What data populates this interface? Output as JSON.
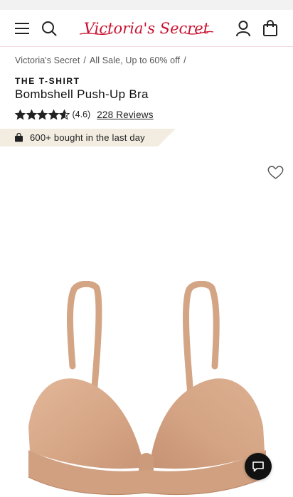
{
  "header": {
    "logo_text": "Victoria's Secret",
    "menu_icon": "hamburger-menu-icon",
    "search_icon": "search-icon",
    "account_icon": "user-icon",
    "bag_icon": "shopping-bag-icon",
    "logo_color": "#c8102e"
  },
  "breadcrumb": {
    "items": [
      "Victoria's Secret",
      "All Sale, Up to 60% off"
    ],
    "separator": "/"
  },
  "product": {
    "collection": "THE T-SHIRT",
    "title": "Bombshell Push-Up Bra",
    "rating": 4.6,
    "rating_label": "(4.6)",
    "reviews_label": "228 Reviews",
    "stars_max": 5
  },
  "promo": {
    "text": "600+ bought in the last day",
    "background": "#f3ece1",
    "icon": "shopping-bag-icon"
  },
  "actions": {
    "wishlist_icon": "heart-icon",
    "chat_icon": "chat-bubble-icon"
  },
  "image": {
    "subject": "nude push-up bra",
    "color": "#d9ab8b"
  }
}
